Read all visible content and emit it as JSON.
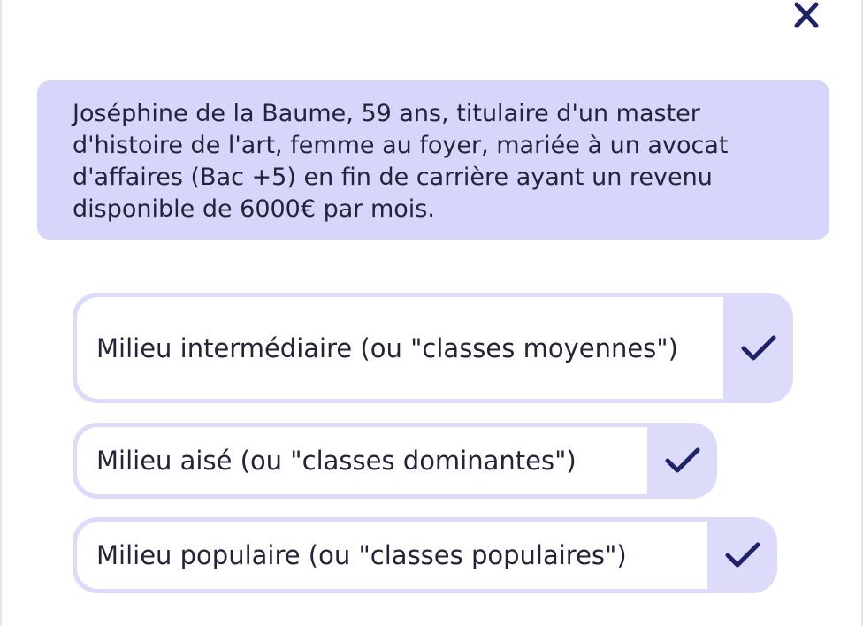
{
  "close_icon": "close-icon",
  "prompt": {
    "text": "Joséphine de la Baume, 59 ans, titulaire d'un master d'histoire de l'art, femme au foyer, mariée à un avocat d'affaires (Bac +5) en fin de carrière ayant un revenu disponible de 6000€ par mois."
  },
  "options": [
    {
      "label": "Milieu intermédiaire (ou \"classes moyennes\")",
      "icon": "checkmark-icon"
    },
    {
      "label": "Milieu aisé (ou \"classes dominantes\")",
      "icon": "checkmark-icon"
    },
    {
      "label": "Milieu populaire (ou \"classes populaires\")",
      "icon": "checkmark-icon"
    }
  ],
  "colors": {
    "card_background": "#d6d6fb",
    "option_border": "#dcdcfa",
    "accent": "#1e2266"
  }
}
